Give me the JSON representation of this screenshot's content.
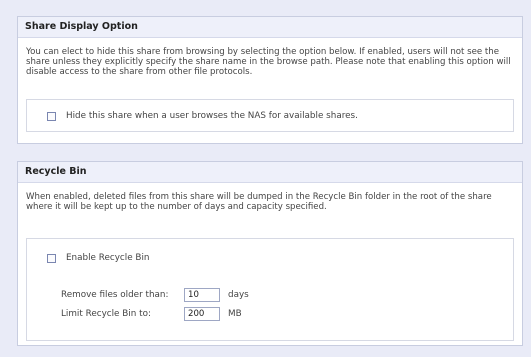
{
  "share_display": {
    "title": "Share Display Option",
    "description": "You can elect to hide this share from browsing by selecting the option below. If enabled, users will not see the share unless they explicitly specify the share name in the browse path. Please note that enabling this option will disable access to the share from other file protocols.",
    "hide_label": "Hide this share when a user browses the NAS for available shares.",
    "hide_checked": false
  },
  "recycle_bin": {
    "title": "Recycle Bin",
    "description": "When enabled, deleted files from this share will be dumped in the Recycle Bin folder in the root of the share where it will be kept up to the number of days and capacity specified.",
    "enable_label": "Enable Recycle Bin",
    "enable_checked": false,
    "remove_label": "Remove files older than:",
    "remove_value": "10",
    "remove_unit": "days",
    "limit_label": "Limit Recycle Bin to:",
    "limit_value": "200",
    "limit_unit": "MB"
  }
}
